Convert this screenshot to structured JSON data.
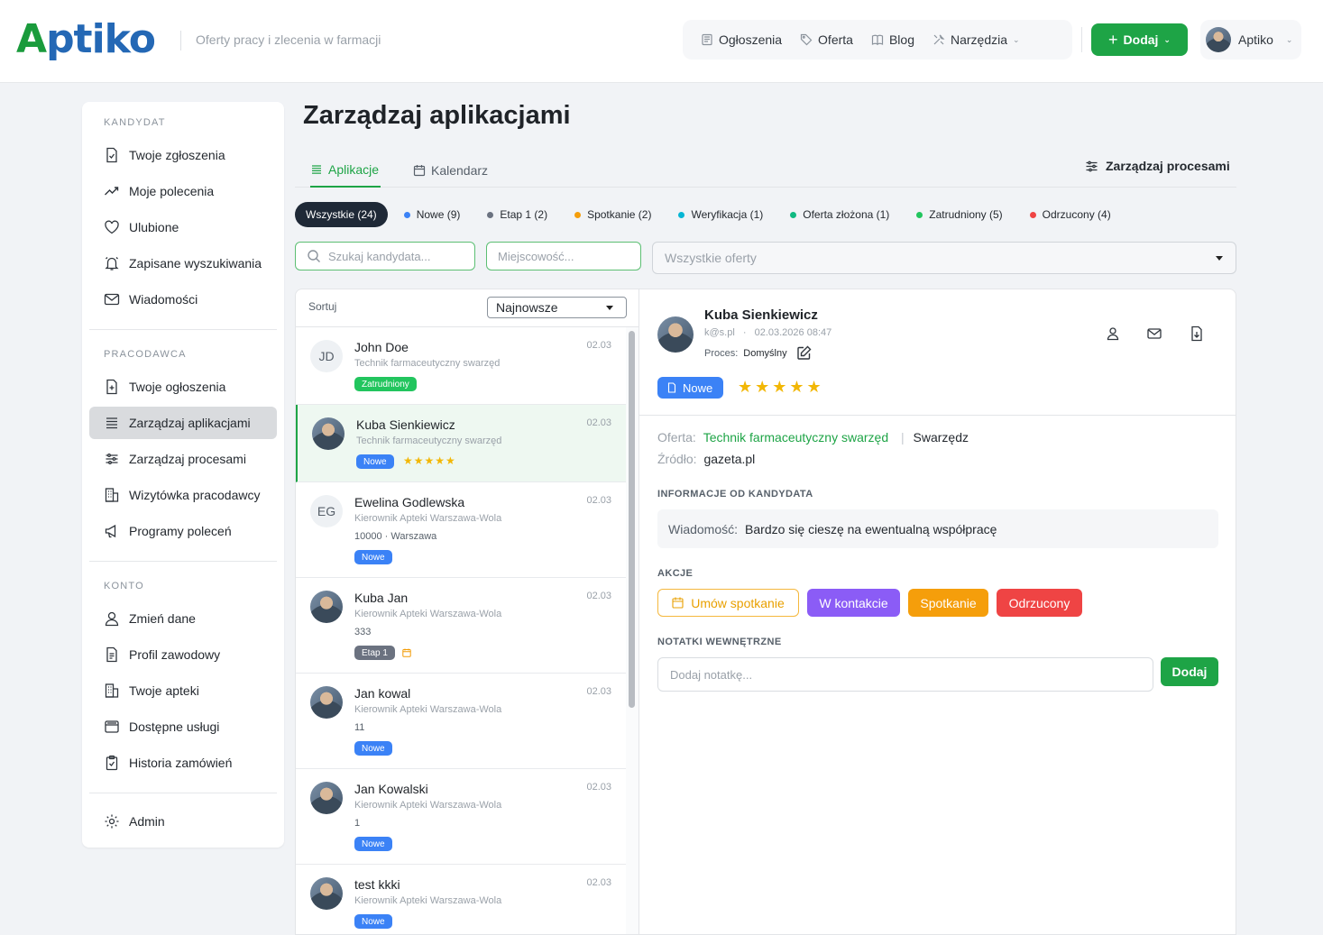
{
  "header": {
    "logo_first": "A",
    "logo_rest": "ptiko",
    "tagline": "Oferty pracy i zlecenia w farmacji",
    "nav": [
      {
        "label": "Ogłoszenia",
        "icon": "newspaper-icon"
      },
      {
        "label": "Oferta",
        "icon": "tag-icon"
      },
      {
        "label": "Blog",
        "icon": "book-icon"
      },
      {
        "label": "Narzędzia",
        "icon": "tools-icon"
      }
    ],
    "add_label": "Dodaj",
    "user_name": "Aptiko"
  },
  "sidebar": {
    "sections": [
      {
        "title": "KANDYDAT",
        "items": [
          "Twoje zgłoszenia",
          "Moje polecenia",
          "Ulubione",
          "Zapisane wyszukiwania",
          "Wiadomości"
        ]
      },
      {
        "title": "PRACODAWCA",
        "items": [
          "Twoje ogłoszenia",
          "Zarządzaj aplikacjami",
          "Zarządzaj procesami",
          "Wizytówka pracodawcy",
          "Programy poleceń"
        ]
      },
      {
        "title": "KONTO",
        "items": [
          "Zmień dane",
          "Profil zawodowy",
          "Twoje apteki",
          "Dostępne usługi",
          "Historia zamówień"
        ]
      }
    ],
    "admin": "Admin",
    "active_item": "Zarządzaj aplikacjami"
  },
  "main": {
    "title": "Zarządzaj aplikacjami",
    "tabs": [
      "Aplikacje",
      "Kalendarz"
    ],
    "active_tab": "Aplikacje",
    "manage_processes": "Zarządzaj procesami",
    "filters": [
      {
        "label": "Wszystkie (24)",
        "color": ""
      },
      {
        "label": "Nowe (9)",
        "color": "#3b82f6"
      },
      {
        "label": "Etap 1 (2)",
        "color": "#6b7280"
      },
      {
        "label": "Spotkanie (2)",
        "color": "#f59e0b"
      },
      {
        "label": "Weryfikacja (1)",
        "color": "#06b6d4"
      },
      {
        "label": "Oferta złożona (1)",
        "color": "#10b981"
      },
      {
        "label": "Zatrudniony (5)",
        "color": "#22c55e"
      },
      {
        "label": "Odrzucony (4)",
        "color": "#ef4444"
      }
    ],
    "search_placeholder": "Szukaj kandydata...",
    "city_placeholder": "Miejscowość...",
    "offers_select": "Wszystkie oferty"
  },
  "list": {
    "sort_label": "Sortuj",
    "sort_value": "Najnowsze",
    "candidates": [
      {
        "name": "John Doe",
        "initials": "JD",
        "job": "Technik farmaceutyczny swarzęd",
        "date": "02.03",
        "extra": "",
        "badge": "Zatrudniony",
        "badge_color": "#22c55e",
        "stars": "",
        "calendar": false
      },
      {
        "name": "Kuba Sienkiewicz",
        "initials": "",
        "job": "Technik farmaceutyczny swarzęd",
        "date": "02.03",
        "extra": "",
        "badge": "Nowe",
        "badge_color": "#3b82f6",
        "stars": "★★★★★",
        "calendar": false
      },
      {
        "name": "Ewelina Godlewska",
        "initials": "EG",
        "job": "Kierownik Apteki Warszawa-Wola",
        "date": "02.03",
        "extra": "10000 · Warszawa",
        "badge": "Nowe",
        "badge_color": "#3b82f6",
        "stars": "",
        "calendar": false
      },
      {
        "name": "Kuba Jan",
        "initials": "",
        "job": "Kierownik Apteki Warszawa-Wola",
        "date": "02.03",
        "extra": "333",
        "badge": "Etap 1",
        "badge_color": "#6b7280",
        "stars": "",
        "calendar": true
      },
      {
        "name": "Jan kowal",
        "initials": "",
        "job": "Kierownik Apteki Warszawa-Wola",
        "date": "02.03",
        "extra": "11",
        "badge": "Nowe",
        "badge_color": "#3b82f6",
        "stars": "",
        "calendar": false
      },
      {
        "name": "Jan Kowalski",
        "initials": "",
        "job": "Kierownik Apteki Warszawa-Wola",
        "date": "02.03",
        "extra": "1",
        "badge": "Nowe",
        "badge_color": "#3b82f6",
        "stars": "",
        "calendar": false
      },
      {
        "name": "test kkki",
        "initials": "",
        "job": "Kierownik Apteki Warszawa-Wola",
        "date": "02.03",
        "extra": "",
        "badge": "Nowe",
        "badge_color": "#3b82f6",
        "stars": "",
        "calendar": false
      }
    ]
  },
  "detail": {
    "name": "Kuba Sienkiewicz",
    "email": "k@s.pl",
    "datetime": "02.03.2026 08:47",
    "process_label": "Proces:",
    "process_value": "Domyślny",
    "status": "Nowe",
    "stars": "★★★★★",
    "offer_label": "Oferta:",
    "offer_value": "Technik farmaceutyczny swarzęd",
    "offer_city": "Swarzędz",
    "source_label": "Źródło:",
    "source_value": "gazeta.pl",
    "info_title": "INFORMACJE OD KANDYDATA",
    "message_label": "Wiadomość:",
    "message_value": "Bardzo się cieszę na ewentualną współpracę",
    "actions_title": "AKCJE",
    "actions": [
      "Umów spotkanie",
      "W kontakcie",
      "Spotkanie",
      "Odrzucony"
    ],
    "notes_title": "NOTATKI WEWNĘTRZNE",
    "note_placeholder": "Dodaj notatkę...",
    "note_button": "Dodaj"
  }
}
